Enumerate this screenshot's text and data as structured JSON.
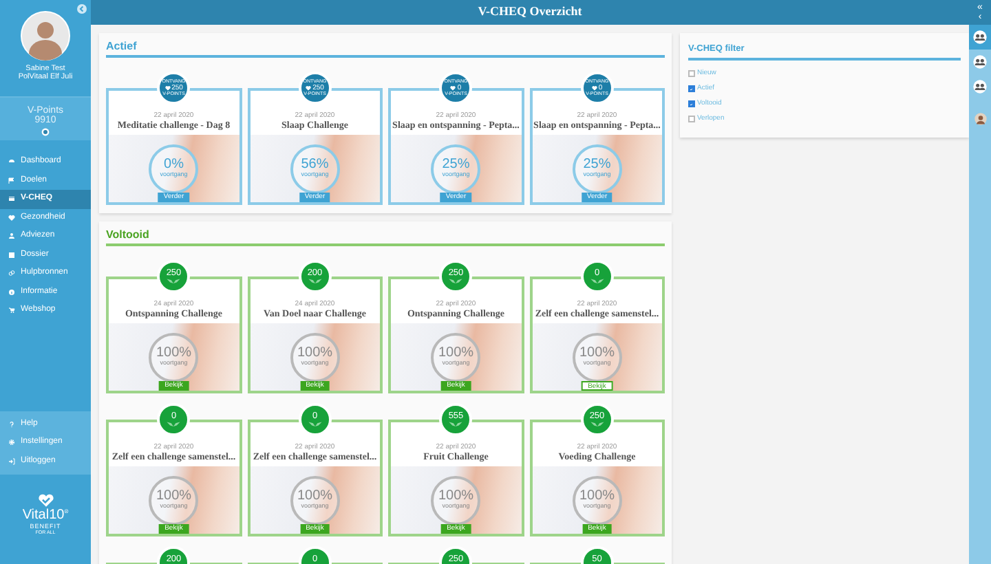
{
  "header": {
    "title": "V-CHEQ Overzicht"
  },
  "sidebar": {
    "user_name": "Sabine Test",
    "organisation": "PolVitaal Elf Juli",
    "points_label": "V-Points",
    "points_value": "9910",
    "nav": [
      {
        "label": "Dashboard",
        "selected": false
      },
      {
        "label": "Doelen",
        "selected": false
      },
      {
        "label": "V-CHEQ",
        "selected": true
      },
      {
        "label": "Gezondheid",
        "selected": false
      },
      {
        "label": "Adviezen",
        "selected": false
      },
      {
        "label": "Dossier",
        "selected": false
      },
      {
        "label": "Hulpbronnen",
        "selected": false
      },
      {
        "label": "Informatie",
        "selected": false
      },
      {
        "label": "Webshop",
        "selected": false
      }
    ],
    "bottom_nav": [
      {
        "label": "Help"
      },
      {
        "label": "Instellingen"
      },
      {
        "label": "Uitloggen"
      }
    ],
    "logo": {
      "name": "Vital10",
      "mark": "®",
      "tagline": "BENEFIT",
      "subtagline": "FOR ALL"
    }
  },
  "sections": [
    {
      "title": "Actief",
      "kind": "active",
      "cards": [
        {
          "badge_top": "ONTVANG",
          "points": "250",
          "badge_bottom": "V-POINTS",
          "date": "22 april 2020",
          "title": "Meditatie challenge - Dag 8",
          "progress": "0%",
          "progress_label": "voortgang",
          "button": "Verder",
          "outlined": false
        },
        {
          "badge_top": "ONTVANG",
          "points": "250",
          "badge_bottom": "V-POINTS",
          "date": "22 april 2020",
          "title": "Slaap Challenge",
          "progress": "56%",
          "progress_label": "voortgang",
          "button": "Verder",
          "outlined": false
        },
        {
          "badge_top": "ONTVANG",
          "points": "0",
          "badge_bottom": "V-POINTS",
          "date": "22 april 2020",
          "title": "Slaap en ontspanning - Pepta...",
          "progress": "25%",
          "progress_label": "voortgang",
          "button": "Verder",
          "outlined": false
        },
        {
          "badge_top": "ONTVANG",
          "points": "0",
          "badge_bottom": "V-POINTS",
          "date": "22 april 2020",
          "title": "Slaap en ontspanning - Pepta...",
          "progress": "25%",
          "progress_label": "voortgang",
          "button": "Verder",
          "outlined": false
        }
      ]
    },
    {
      "title": "Voltooid",
      "kind": "completed",
      "cards": [
        {
          "points": "250",
          "date": "24 april 2020",
          "title": "Ontspanning Challenge",
          "progress": "100%",
          "progress_label": "voortgang",
          "button": "Bekijk",
          "outlined": false
        },
        {
          "points": "200",
          "date": "24 april 2020",
          "title": "Van Doel naar Challenge",
          "progress": "100%",
          "progress_label": "voortgang",
          "button": "Bekijk",
          "outlined": false
        },
        {
          "points": "250",
          "date": "22 april 2020",
          "title": "Ontspanning Challenge",
          "progress": "100%",
          "progress_label": "voortgang",
          "button": "Bekijk",
          "outlined": false
        },
        {
          "points": "0",
          "date": "22 april 2020",
          "title": "Zelf een challenge samenstel...",
          "progress": "100%",
          "progress_label": "voortgang",
          "button": "Bekijk",
          "outlined": true
        },
        {
          "points": "0",
          "date": "22 april 2020",
          "title": "Zelf een challenge samenstel...",
          "progress": "100%",
          "progress_label": "voortgang",
          "button": "Bekijk",
          "outlined": false
        },
        {
          "points": "0",
          "date": "22 april 2020",
          "title": "Zelf een challenge samenstel...",
          "progress": "100%",
          "progress_label": "voortgang",
          "button": "Bekijk",
          "outlined": false
        },
        {
          "points": "555",
          "date": "22 april 2020",
          "title": "Fruit Challenge",
          "progress": "100%",
          "progress_label": "voortgang",
          "button": "Bekijk",
          "outlined": false
        },
        {
          "points": "250",
          "date": "22 april 2020",
          "title": "Voeding Challenge",
          "progress": "100%",
          "progress_label": "voortgang",
          "button": "Bekijk",
          "outlined": false
        },
        {
          "points": "200"
        },
        {
          "points": "0"
        },
        {
          "points": "250"
        },
        {
          "points": "50"
        }
      ]
    }
  ],
  "filter": {
    "title": "V-CHEQ filter",
    "options": [
      {
        "label": "Nieuw",
        "checked": false
      },
      {
        "label": "Actief",
        "checked": true
      },
      {
        "label": "Voltooid",
        "checked": true
      },
      {
        "label": "Verlopen",
        "checked": false
      }
    ]
  },
  "right_bar": {
    "top_glyph": "«",
    "collapse_glyph": "‹",
    "icons": [
      {
        "kind": "group",
        "selected": true
      },
      {
        "kind": "group",
        "selected": false
      },
      {
        "kind": "group",
        "selected": false
      },
      {
        "kind": "avatar",
        "selected": false
      }
    ]
  }
}
